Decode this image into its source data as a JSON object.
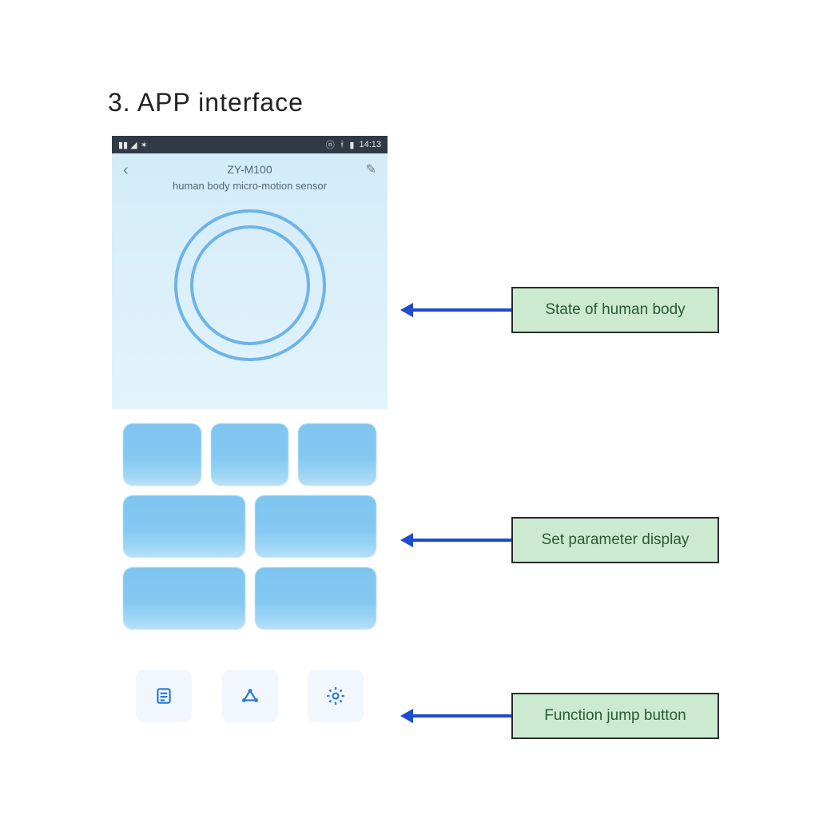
{
  "heading": "3. APP interface",
  "status_bar": {
    "time": "14:13"
  },
  "app": {
    "title_line1": "ZY-M100",
    "title_line2": "human body micro-motion sensor"
  },
  "callouts": {
    "c1": "State of human body",
    "c2": "Set parameter display",
    "c3": "Function jump button"
  },
  "icons": {
    "back": "back-icon",
    "edit": "edit-icon",
    "list": "list-icon",
    "share": "share-icon",
    "gear": "gear-icon"
  }
}
